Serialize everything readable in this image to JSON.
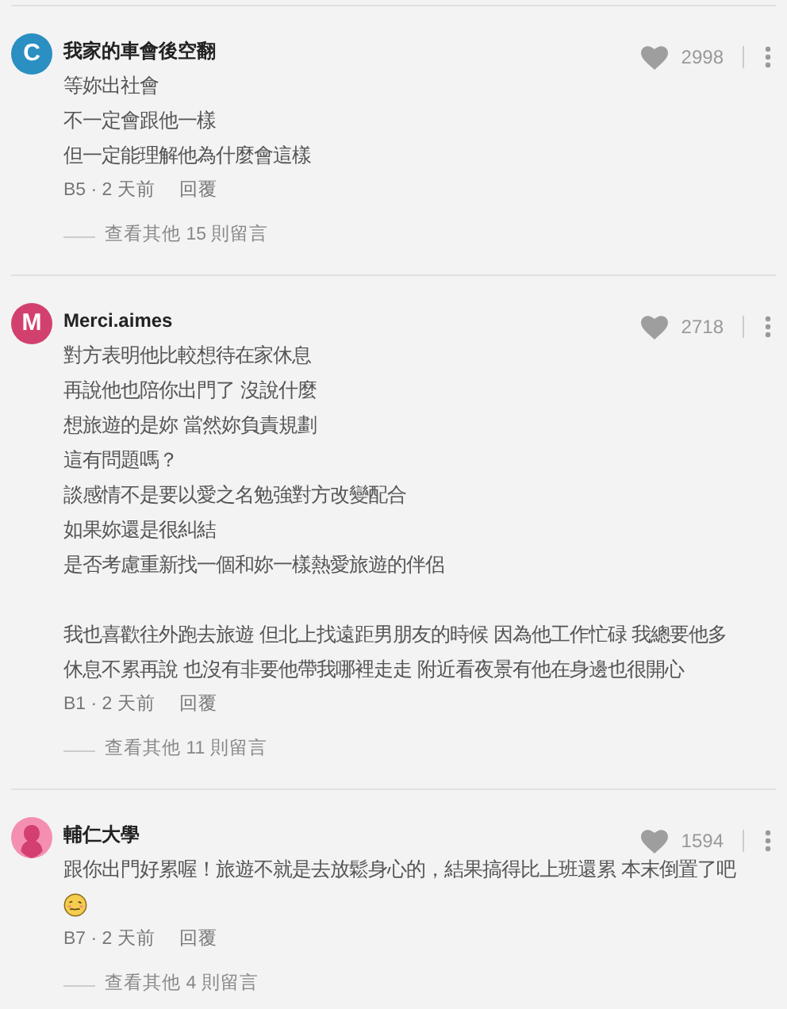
{
  "comments": [
    {
      "author": "我家的車會後空翻",
      "avatar": {
        "kind": "letter",
        "letter": "C",
        "color": "#2b8fc1"
      },
      "likes": "2998",
      "blocks": [
        {
          "kind": "text",
          "lines": [
            "等妳出社會",
            "不一定會跟他一樣",
            "但一定能理解他為什麼會這樣"
          ]
        }
      ],
      "meta": "B5 · 2 天前",
      "reply": "回覆",
      "more_replies": "查看其他 15 則留言"
    },
    {
      "author": "Merci.aimes",
      "avatar": {
        "kind": "letter",
        "letter": "M",
        "color": "#d2416e"
      },
      "likes": "2718",
      "blocks": [
        {
          "kind": "text",
          "lines": [
            "對方表明他比較想待在家休息",
            "再說他也陪你出門了 沒說什麼",
            "想旅遊的是妳 當然妳負責規劃",
            "這有問題嗎？",
            "談感情不是要以愛之名勉強對方改變配合",
            "如果妳還是很糾結",
            "是否考慮重新找一個和妳一樣熱愛旅遊的伴侶"
          ]
        },
        {
          "kind": "text",
          "lines": [
            "我也喜歡往外跑去旅遊 但北上找遠距男朋友的時候 因為他工作忙碌 我總要他多",
            "休息不累再說 也沒有非要他帶我哪裡走走 附近看夜景有他在身邊也很開心"
          ]
        }
      ],
      "meta": "B1 · 2 天前",
      "reply": "回覆",
      "more_replies": "查看其他 11 則留言"
    },
    {
      "author": "輔仁大學",
      "avatar": {
        "kind": "silhouette",
        "color": "#f48fb1"
      },
      "likes": "1594",
      "blocks": [
        {
          "kind": "text",
          "lines": [
            "跟你出門好累喔！旅遊不就是去放鬆身心的，結果搞得比上班還累 本末倒置了吧"
          ]
        },
        {
          "kind": "emoji"
        }
      ],
      "meta": "B7 · 2 天前",
      "reply": "回覆",
      "more_replies": "查看其他 4 則留言"
    }
  ]
}
